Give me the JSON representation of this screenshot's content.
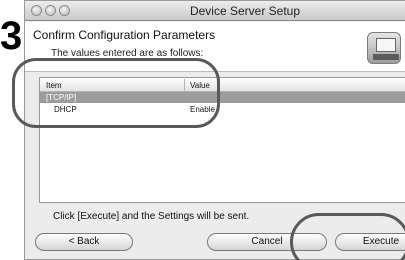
{
  "step": "3.",
  "window": {
    "title": "Device Server Setup"
  },
  "header": {
    "title": "Confirm Configuration Parameters",
    "subtitle": "The values entered are as follows:",
    "icon": "computer-setup-icon"
  },
  "table": {
    "columns": [
      "Item",
      "Value"
    ],
    "section": "[TCP/IP]",
    "rows": [
      {
        "item": "DHCP",
        "value": "Enable"
      }
    ]
  },
  "footer": {
    "instruction": "Click [Execute] and the Settings will be sent."
  },
  "buttons": {
    "back": "< Back",
    "cancel": "Cancel",
    "execute": "Execute"
  },
  "colors": {
    "annotation": "#595959",
    "section_row": "#9c9c9c"
  }
}
